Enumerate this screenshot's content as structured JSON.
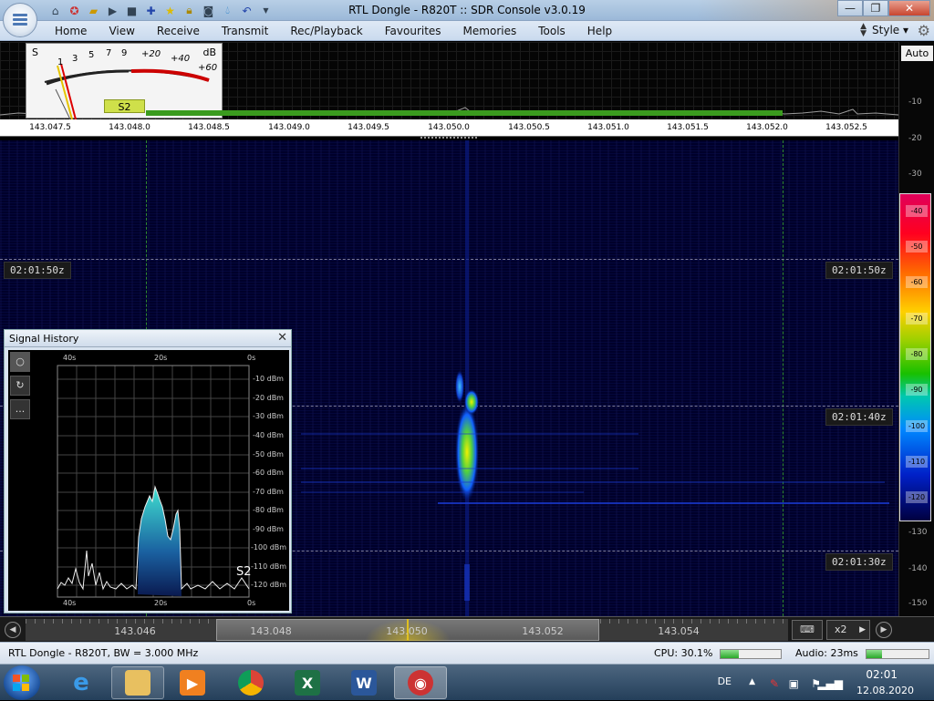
{
  "window": {
    "title": "RTL Dongle - R820T :: SDR Console v3.0.19",
    "buttons": [
      "—",
      "❐",
      "✕"
    ]
  },
  "qat_icons": [
    "home-icon",
    "lifebuoy-icon",
    "folder-icon",
    "play-icon",
    "stop-icon",
    "plus-icon",
    "star-icon",
    "lock-icon",
    "camera-icon",
    "dropper-icon",
    "undo-icon",
    "dropdown-icon"
  ],
  "menu": {
    "items": [
      "Home",
      "View",
      "Receive",
      "Transmit",
      "Rec/Playback",
      "Favourites",
      "Memories",
      "Tools",
      "Help"
    ],
    "style_label": "Style"
  },
  "smeter": {
    "s_label": "S",
    "db_label": "dB",
    "scale": [
      "1",
      "3",
      "5",
      "7",
      "9",
      "+20",
      "+40",
      "+60"
    ],
    "reading": "S2"
  },
  "freq_scale": [
    "143.047.5",
    "143.048.0",
    "143.048.5",
    "143.049.0",
    "143.049.5",
    "143.050.0",
    "143.050.5",
    "143.051.0",
    "143.051.5",
    "143.052.0",
    "143.052.5"
  ],
  "timestamps": {
    "t1": "02:01:50z",
    "t2": "02:01:40z",
    "t3": "02:01:30z"
  },
  "db_scale": {
    "auto_label": "Auto",
    "ticks": [
      "-10",
      "-20",
      "-30",
      "-130",
      "-140",
      "-150"
    ],
    "colorbar": [
      "-40",
      "-50",
      "-60",
      "-70",
      "-80",
      "-90",
      "-100",
      "-110",
      "-120"
    ]
  },
  "signal_history": {
    "title": "Signal History",
    "close": "✕",
    "buttons": [
      "○",
      "↻",
      "..."
    ],
    "time_top": [
      "40s",
      "20s",
      "0s"
    ],
    "time_bottom": [
      "40s",
      "20s",
      "0s"
    ],
    "dbm_labels": [
      "-10 dBm",
      "-20 dBm",
      "-30 dBm",
      "-40 dBm",
      "-50 dBm",
      "-60 dBm",
      "-70 dBm",
      "-80 dBm",
      "-90 dBm",
      "-100 dBm",
      "-110 dBm",
      "-120 dBm"
    ],
    "reading": "S2"
  },
  "bottom_scale": {
    "freqs": [
      "143.046",
      "143.048",
      "143.050",
      "143.052",
      "143.054"
    ],
    "zoom": "x2"
  },
  "status": {
    "device": "RTL Dongle - R820T, BW = 3.000 MHz",
    "cpu": "CPU: 30.1%",
    "cpu_level": 0.3,
    "audio": "Audio: 23ms",
    "audio_level": 0.25
  },
  "taskbar": {
    "apps": [
      "start-button",
      "internet-explorer",
      "file-explorer",
      "media-player",
      "chrome",
      "excel",
      "word",
      "sdr-console"
    ],
    "lang": "DE",
    "time": "02:01",
    "date": "12.08.2020"
  }
}
